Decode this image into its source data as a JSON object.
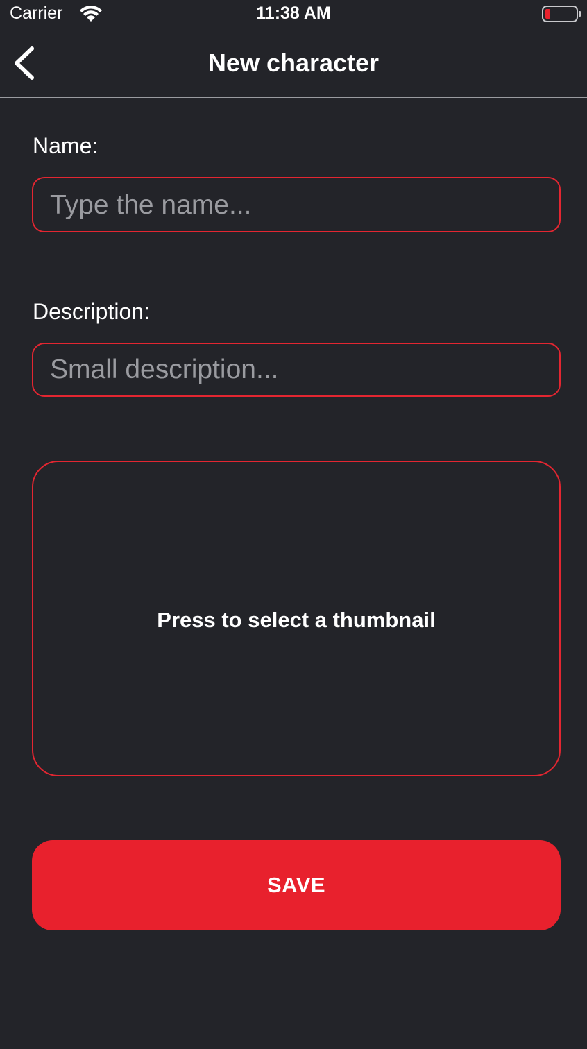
{
  "status_bar": {
    "carrier": "Carrier",
    "time": "11:38 AM",
    "wifi_icon": "wifi-icon",
    "battery_icon": "battery-low-icon",
    "battery_color": "#e8212d"
  },
  "nav": {
    "title": "New character",
    "back_icon": "chevron-left-icon"
  },
  "form": {
    "name_label": "Name:",
    "name_value": "",
    "name_placeholder": "Type the name...",
    "description_label": "Description:",
    "description_value": "",
    "description_placeholder": "Small description...",
    "thumbnail_prompt": "Press to select a thumbnail",
    "save_label": "SAVE"
  },
  "colors": {
    "background": "#232429",
    "accent": "#e8212d",
    "placeholder": "#9a9ba0"
  }
}
